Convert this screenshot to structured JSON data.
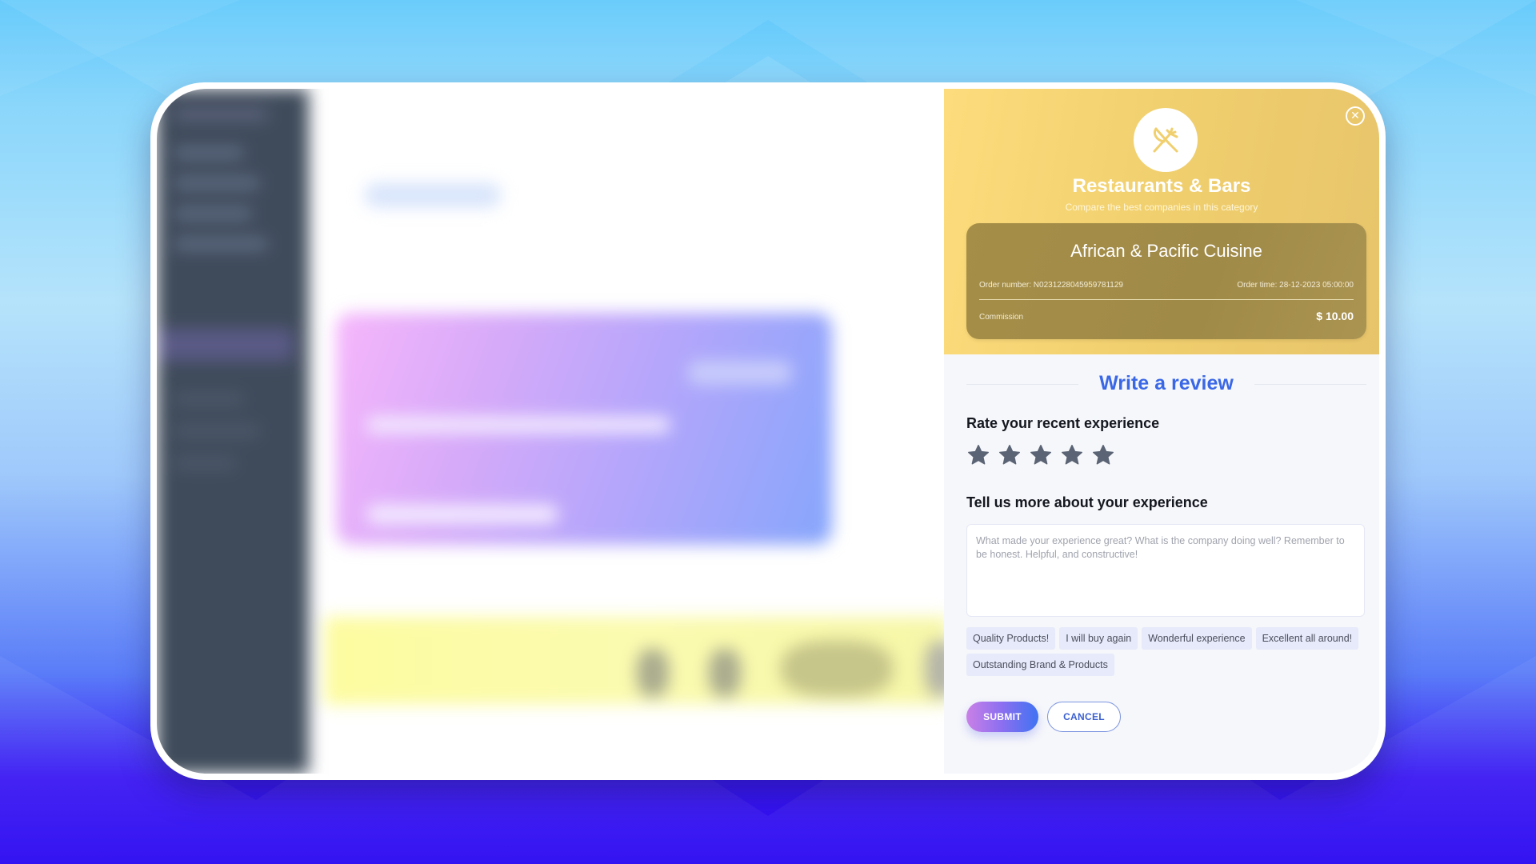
{
  "background": {
    "top_color": "#5ec8fb",
    "bottom_color": "#2a07f2"
  },
  "review_panel": {
    "close_icon": "close-circle-icon",
    "category": {
      "icon": "utensils-icon",
      "title": "Restaurants & Bars",
      "subtitle": "Compare the best companies in this category",
      "accent_color": "#f0cf6e"
    },
    "order": {
      "vendor_name": "African & Pacific Cuisine",
      "order_number": "Order number: N0231228045959781129",
      "order_time": "Order time: 28-12-2023 05:00:00",
      "commission_label": "Commission",
      "commission_value": "$ 10.00"
    },
    "heading": "Write a review",
    "heading_color": "#3a67e6",
    "rating": {
      "label": "Rate your recent experience",
      "max_stars": 5,
      "selected": 0,
      "star_icon": "star-icon",
      "star_color": "#5b6474"
    },
    "details": {
      "label": "Tell us more about your experience",
      "value": "",
      "placeholder": "What made your experience great? What is the company doing well? Remember to be honest. Helpful, and constructive!"
    },
    "quick_tags": [
      "Quality Products!",
      "I will buy again",
      "Wonderful experience",
      "Excellent all around!",
      "Outstanding Brand & Products"
    ],
    "actions": {
      "submit_label": "SUBMIT",
      "cancel_label": "CANCEL"
    }
  }
}
